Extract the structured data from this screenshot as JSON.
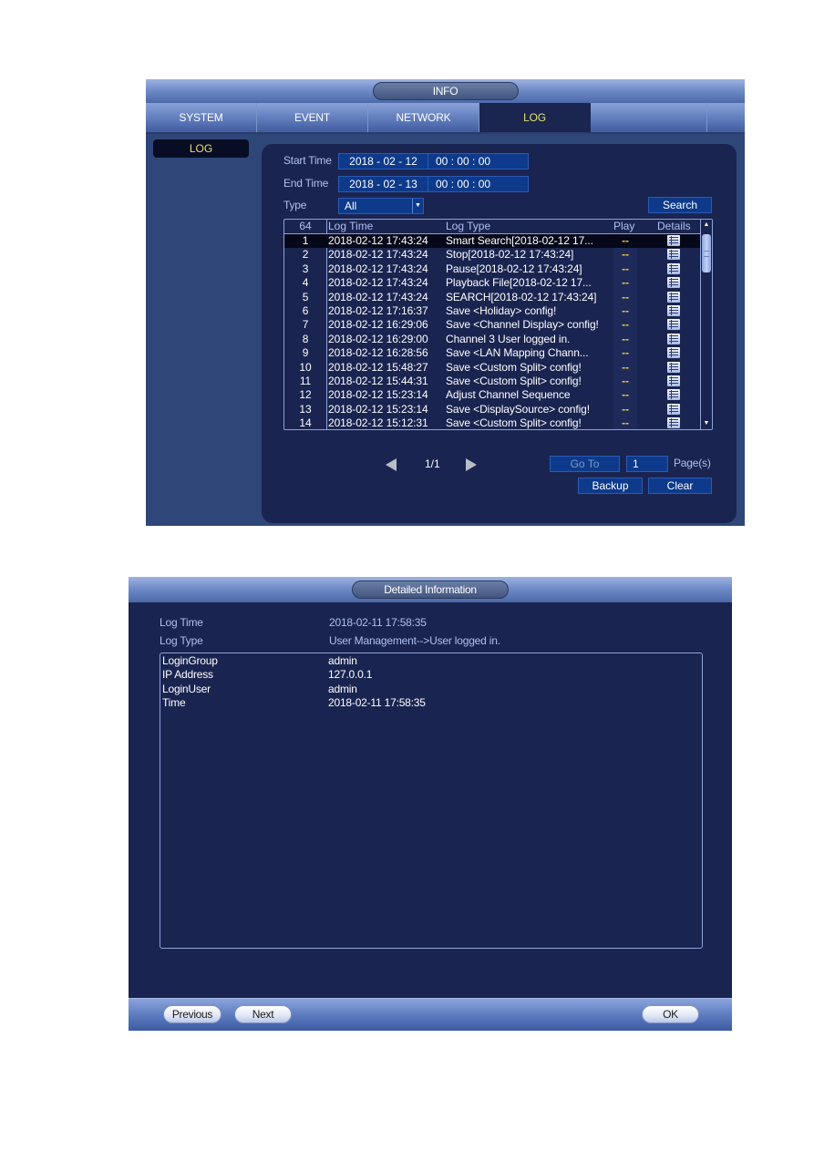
{
  "info_window": {
    "title": "INFO",
    "tabs": [
      {
        "label": "SYSTEM",
        "active": false
      },
      {
        "label": "EVENT",
        "active": false
      },
      {
        "label": "NETWORK",
        "active": false
      },
      {
        "label": "LOG",
        "active": true
      }
    ],
    "sidebar": {
      "items": [
        {
          "label": "LOG",
          "active": true
        }
      ]
    },
    "filters": {
      "start_time": {
        "label": "Start Time",
        "date": "2018 - 02 - 12",
        "time": "00 : 00 : 00"
      },
      "end_time": {
        "label": "End Time",
        "date": "2018 - 02 - 13",
        "time": "00 : 00 : 00"
      },
      "type": {
        "label": "Type",
        "value": "All"
      },
      "search_label": "Search"
    },
    "table": {
      "columns": {
        "count": "64",
        "log_time": "Log Time",
        "log_type": "Log Type",
        "play": "Play",
        "details": "Details"
      },
      "rows": [
        {
          "no": "1",
          "time": "2018-02-12 17:43:24",
          "type": "Smart Search[2018-02-12 17...",
          "play": "--",
          "selected": true
        },
        {
          "no": "2",
          "time": "2018-02-12 17:43:24",
          "type": "Stop[2018-02-12 17:43:24]",
          "play": "--"
        },
        {
          "no": "3",
          "time": "2018-02-12 17:43:24",
          "type": "Pause[2018-02-12 17:43:24]",
          "play": "--"
        },
        {
          "no": "4",
          "time": "2018-02-12 17:43:24",
          "type": "Playback File[2018-02-12 17...",
          "play": "--"
        },
        {
          "no": "5",
          "time": "2018-02-12 17:43:24",
          "type": "SEARCH[2018-02-12 17:43:24]",
          "play": "--"
        },
        {
          "no": "6",
          "time": "2018-02-12 17:16:37",
          "type": "Save <Holiday> config!",
          "play": "--"
        },
        {
          "no": "7",
          "time": "2018-02-12 16:29:06",
          "type": "Save <Channel Display> config!",
          "play": "--"
        },
        {
          "no": "8",
          "time": "2018-02-12 16:29:00",
          "type": "Channel 3 User logged in.",
          "play": "--"
        },
        {
          "no": "9",
          "time": "2018-02-12 16:28:56",
          "type": "Save <LAN Mapping Chann...",
          "play": "--"
        },
        {
          "no": "10",
          "time": "2018-02-12 15:48:27",
          "type": "Save <Custom Split> config!",
          "play": "--"
        },
        {
          "no": "11",
          "time": "2018-02-12 15:44:31",
          "type": "Save <Custom Split> config!",
          "play": "--"
        },
        {
          "no": "12",
          "time": "2018-02-12 15:23:14",
          "type": "Adjust Channel Sequence",
          "play": "--"
        },
        {
          "no": "13",
          "time": "2018-02-12 15:23:14",
          "type": "Save <DisplaySource> config!",
          "play": "--"
        },
        {
          "no": "14",
          "time": "2018-02-12 15:12:31",
          "type": "Save <Custom Split> config!",
          "play": "--"
        }
      ]
    },
    "pager": {
      "indicator": "1/1",
      "goto_label": "Go To",
      "page_input": "1",
      "pages_label": "Page(s)"
    },
    "actions": {
      "backup_label": "Backup",
      "clear_label": "Clear"
    }
  },
  "detail_window": {
    "title": "Detailed Information",
    "log_time": {
      "label": "Log Time",
      "value": "2018-02-11 17:58:35"
    },
    "log_type": {
      "label": "Log Type",
      "value": "User Management-->User logged in."
    },
    "details": [
      {
        "key": "LoginGroup",
        "value": "admin"
      },
      {
        "key": "IP Address",
        "value": "127.0.0.1"
      },
      {
        "key": "LoginUser",
        "value": "admin"
      },
      {
        "key": "Time",
        "value": "2018-02-11 17:58:35"
      }
    ],
    "buttons": {
      "previous": "Previous",
      "next": "Next",
      "ok": "OK"
    }
  },
  "colors": {
    "accent_yellow": "#e8e070",
    "play_dash": "#e8d040",
    "panel_dark": "#1a2450",
    "field_blue": "#0d3a8a",
    "label_blue": "#aec0f0"
  }
}
